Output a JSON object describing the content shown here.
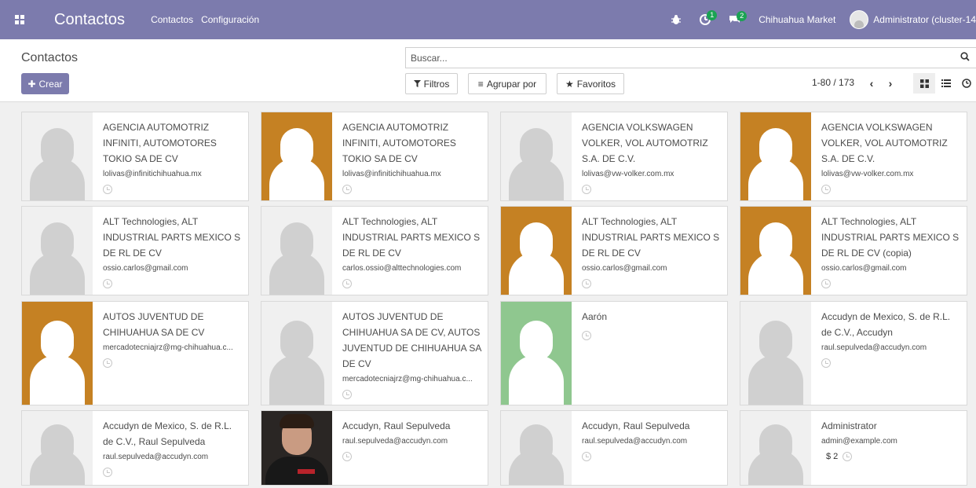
{
  "navbar": {
    "app_title": "Contactos",
    "menu": [
      "Contactos",
      "Configuración"
    ],
    "debug_icon": "bug-icon",
    "activity_badge": "1",
    "messages_badge": "2",
    "company": "Chihuahua Market",
    "user": "Administrator (cluster-14"
  },
  "control": {
    "breadcrumb": "Contactos",
    "create_label": "Crear",
    "search_placeholder": "Buscar...",
    "filters_label": "Filtros",
    "group_label": "Agrupar por",
    "favorites_label": "Favoritos",
    "pager": "1-80 / 173"
  },
  "cards": [
    {
      "name": "AGENCIA AUTOMOTRIZ INFINITI, AUTOMOTORES TOKIO SA DE CV",
      "email": "lolivas@infinitichihuahua.mx",
      "image": "gray"
    },
    {
      "name": "AGENCIA AUTOMOTRIZ INFINITI, AUTOMOTORES TOKIO SA DE CV",
      "email": "lolivas@infinitichihuahua.mx",
      "image": "orange"
    },
    {
      "name": "AGENCIA VOLKSWAGEN VOLKER, VOL AUTOMOTRIZ S.A. DE C.V.",
      "email": "lolivas@vw-volker.com.mx",
      "image": "gray"
    },
    {
      "name": "AGENCIA VOLKSWAGEN VOLKER, VOL AUTOMOTRIZ S.A. DE C.V.",
      "email": "lolivas@vw-volker.com.mx",
      "image": "orange"
    },
    {
      "name": "ALT Technologies, ALT INDUSTRIAL PARTS MEXICO S DE RL DE CV",
      "email": "ossio.carlos@gmail.com",
      "image": "gray"
    },
    {
      "name": "ALT Technologies, ALT INDUSTRIAL PARTS MEXICO S DE RL DE CV",
      "email": "carlos.ossio@alttechnologies.com",
      "image": "gray"
    },
    {
      "name": "ALT Technologies, ALT INDUSTRIAL PARTS MEXICO S DE RL DE CV",
      "email": "ossio.carlos@gmail.com",
      "image": "orange"
    },
    {
      "name": "ALT Technologies, ALT INDUSTRIAL PARTS MEXICO S DE RL DE CV (copia)",
      "email": "ossio.carlos@gmail.com",
      "image": "orange"
    },
    {
      "name": "AUTOS JUVENTUD DE CHIHUAHUA SA DE CV",
      "email": "mercadotecniajrz@mg-chihuahua.c...",
      "image": "orange"
    },
    {
      "name": "AUTOS JUVENTUD DE CHIHUAHUA SA DE CV, AUTOS JUVENTUD DE CHIHUAHUA SA DE CV",
      "email": "mercadotecniajrz@mg-chihuahua.c...",
      "image": "gray"
    },
    {
      "name": "Aarón",
      "email": "",
      "image": "green"
    },
    {
      "name": "Accudyn de Mexico, S. de R.L. de C.V., Accudyn",
      "email": "raul.sepulveda@accudyn.com",
      "image": "gray"
    },
    {
      "name": "Accudyn de Mexico, S. de R.L. de C.V., Raul Sepulveda",
      "email": "raul.sepulveda@accudyn.com",
      "image": "gray"
    },
    {
      "name": "Accudyn, Raul Sepulveda",
      "email": "raul.sepulveda@accudyn.com",
      "image": "photo"
    },
    {
      "name": "Accudyn, Raul Sepulveda",
      "email": "raul.sepulveda@accudyn.com",
      "image": "gray"
    },
    {
      "name": "Administrator",
      "email": "admin@example.com",
      "image": "gray",
      "amount": "$ 2"
    }
  ]
}
